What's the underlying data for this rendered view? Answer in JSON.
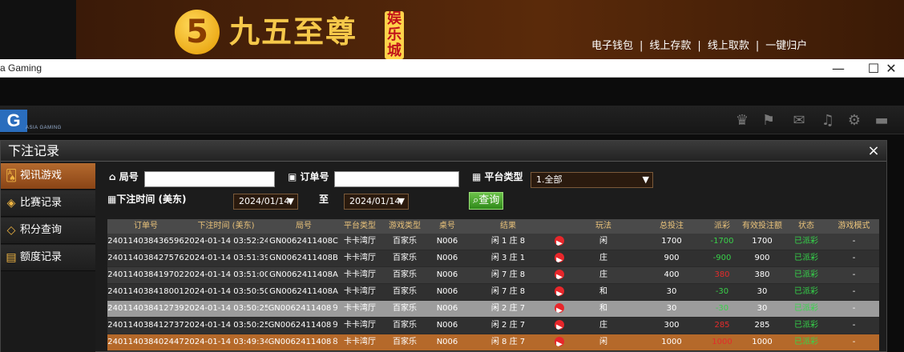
{
  "banner": {
    "logo_num": "5",
    "logo_text": "九五至尊",
    "logo_badge": "娱乐城",
    "links": [
      "电子钱包",
      "线上存款",
      "线上取款",
      "一键归户"
    ],
    "separator": "|"
  },
  "window": {
    "title": "a Gaming",
    "minimize": "—",
    "maximize": "☐",
    "close": "✕"
  },
  "appbar": {
    "logo": "G",
    "logo_sub": "ASIA GAMING",
    "icons": [
      "vip-icon",
      "flag-icon",
      "chat-icon",
      "music-icon",
      "gear-icon",
      "message-icon"
    ]
  },
  "dialog": {
    "title": "下注记录",
    "close": "×",
    "sidebar": [
      {
        "label": "视讯游戏",
        "icon": "cards-icon",
        "active": true
      },
      {
        "label": "比赛记录",
        "icon": "ticket-icon",
        "active": false
      },
      {
        "label": "积分查询",
        "icon": "diamond-icon",
        "active": false
      },
      {
        "label": "额度记录",
        "icon": "document-icon",
        "active": false
      }
    ],
    "filters": {
      "round_label": "局号",
      "round_value": "",
      "order_label": "订单号",
      "order_value": "",
      "platform_label": "平台类型",
      "platform_value": "1.全部",
      "time_label": "下注时间 (美东)",
      "date_from": "2024/01/14",
      "to_label": "至",
      "date_to": "2024/01/14",
      "query_label": "查询"
    },
    "table": {
      "headers": [
        "订单号",
        "下注时间 (美东)",
        "局号",
        "平台类型",
        "游戏类型",
        "桌号",
        "结果",
        "",
        "玩法",
        "总投注",
        "派彩",
        "有效投注额",
        "状态",
        "游戏模式"
      ],
      "rows": [
        {
          "order": "240114038436596",
          "time": "2024-01-14 03:52:24",
          "round": "GN0062411408C",
          "platform": "卡卡湾厅",
          "game": "百家乐",
          "table": "N006",
          "result": "闲 1 庄 8",
          "play": "闲",
          "bet": "1700",
          "payout": "-1700",
          "valid": "1700",
          "status": "已派彩",
          "mode": "-"
        },
        {
          "order": "240114038427576",
          "time": "2024-01-14 03:51:39",
          "round": "GN0062411408B",
          "platform": "卡卡湾厅",
          "game": "百家乐",
          "table": "N006",
          "result": "闲 3 庄 1",
          "play": "庄",
          "bet": "900",
          "payout": "-900",
          "valid": "900",
          "status": "已派彩",
          "mode": "-"
        },
        {
          "order": "240114038419702",
          "time": "2024-01-14 03:51:00",
          "round": "GN0062411408A",
          "platform": "卡卡湾厅",
          "game": "百家乐",
          "table": "N006",
          "result": "闲 7 庄 8",
          "play": "庄",
          "bet": "400",
          "payout": "380",
          "valid": "380",
          "status": "已派彩",
          "mode": "-"
        },
        {
          "order": "240114038418001",
          "time": "2024-01-14 03:50:50",
          "round": "GN0062411408A",
          "platform": "卡卡湾厅",
          "game": "百家乐",
          "table": "N006",
          "result": "闲 7 庄 8",
          "play": "和",
          "bet": "30",
          "payout": "-30",
          "valid": "30",
          "status": "已派彩",
          "mode": "-"
        },
        {
          "order": "240114038412739",
          "time": "2024-01-14 03:50:25",
          "round": "GN0062411408９",
          "platform": "卡卡湾厅",
          "game": "百家乐",
          "table": "N006",
          "result": "闲 2 庄 7",
          "play": "和",
          "bet": "30",
          "payout": "-30",
          "valid": "30",
          "status": "已派彩",
          "mode": "-"
        },
        {
          "order": "240114038412737",
          "time": "2024-01-14 03:50:25",
          "round": "GN0062411408９",
          "platform": "卡卡湾厅",
          "game": "百家乐",
          "table": "N006",
          "result": "闲 2 庄 7",
          "play": "庄",
          "bet": "300",
          "payout": "285",
          "valid": "285",
          "status": "已派彩",
          "mode": "-"
        },
        {
          "order": "240114038402447",
          "time": "2024-01-14 03:49:34",
          "round": "GN0062411408８",
          "platform": "卡卡湾厅",
          "game": "百家乐",
          "table": "N006",
          "result": "闲 8 庄 7",
          "play": "闲",
          "bet": "1000",
          "payout": "1000",
          "valid": "1000",
          "status": "已派彩",
          "mode": "-"
        }
      ],
      "play_icon": "▶"
    }
  }
}
